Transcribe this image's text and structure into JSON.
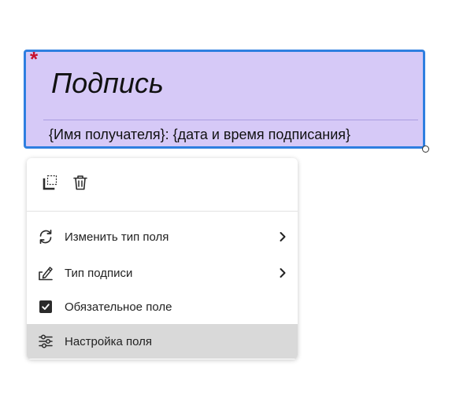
{
  "signature_field": {
    "required_mark": "*",
    "title": "Подпись",
    "caption": "{Имя получателя}: {дата и время подписания}",
    "background_color": "#d6c9f7",
    "border_color": "#2f7fe0"
  },
  "context_menu": {
    "toolbar": {
      "duplicate_icon": "duplicate-field-icon",
      "delete_icon": "trash-icon"
    },
    "items": [
      {
        "label": "Изменить тип поля",
        "icon": "refresh-icon",
        "has_submenu": true
      },
      {
        "label": "Тип подписи",
        "icon": "signature-pen-icon",
        "has_submenu": true
      },
      {
        "label": "Обязательное поле",
        "icon": "checkbox-icon",
        "checked": true
      },
      {
        "label": "Настройка поля",
        "icon": "sliders-icon",
        "active": true
      }
    ]
  }
}
